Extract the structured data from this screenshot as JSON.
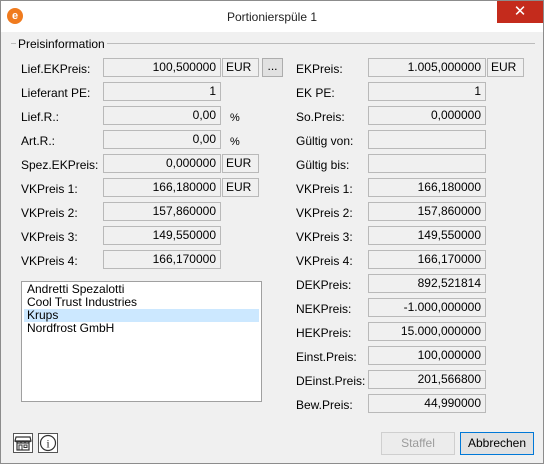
{
  "window": {
    "title": "Portionierspüle 1",
    "close_glyph": "✕",
    "app_icon_letter": "e"
  },
  "group": {
    "label": "Preisinformation"
  },
  "left": {
    "lief_ekpreis": {
      "label": "Lief.EKPreis:",
      "value": "100,500000",
      "currency": "EUR",
      "more_label": "..."
    },
    "lieferant_pe": {
      "label": "Lieferant PE:",
      "value": "1"
    },
    "lief_r": {
      "label": "Lief.R.:",
      "value": "0,00",
      "unit": "%"
    },
    "art_r": {
      "label": "Art.R.:",
      "value": "0,00",
      "unit": "%"
    },
    "spez_ekpreis": {
      "label": "Spez.EKPreis:",
      "value": "0,000000",
      "currency": "EUR"
    },
    "vkpreis1": {
      "label": "VKPreis 1:",
      "value": "166,180000",
      "currency": "EUR"
    },
    "vkpreis2": {
      "label": "VKPreis 2:",
      "value": "157,860000"
    },
    "vkpreis3": {
      "label": "VKPreis 3:",
      "value": "149,550000"
    },
    "vkpreis4": {
      "label": "VKPreis 4:",
      "value": "166,170000"
    }
  },
  "right": {
    "ekpreis": {
      "label": "EKPreis:",
      "value": "1.005,000000",
      "currency": "EUR"
    },
    "ek_pe": {
      "label": "EK PE:",
      "value": "1"
    },
    "so_preis": {
      "label": "So.Preis:",
      "value": "0,000000"
    },
    "gueltig_von": {
      "label": "Gültig von:",
      "value": ""
    },
    "gueltig_bis": {
      "label": "Gültig bis:",
      "value": ""
    },
    "vkpreis1": {
      "label": "VKPreis 1:",
      "value": "166,180000"
    },
    "vkpreis2": {
      "label": "VKPreis 2:",
      "value": "157,860000"
    },
    "vkpreis3": {
      "label": "VKPreis 3:",
      "value": "149,550000"
    },
    "vkpreis4": {
      "label": "VKPreis 4:",
      "value": "166,170000"
    },
    "dekpreis": {
      "label": "DEKPreis:",
      "value": "892,521814"
    },
    "nekpreis": {
      "label": "NEKPreis:",
      "value": "-1.000,000000"
    },
    "hekpreis": {
      "label": "HEKPreis:",
      "value": "15.000,000000"
    },
    "einst_preis": {
      "label": "Einst.Preis:",
      "value": "100,000000"
    },
    "deinst_preis": {
      "label": "DEinst.Preis:",
      "value": "201,566800"
    },
    "bew_preis": {
      "label": "Bew.Preis:",
      "value": "44,990000"
    }
  },
  "suppliers": {
    "items": [
      "Andretti Spezalotti",
      "Cool Trust Industries",
      "Krups",
      "Nordfrost GmbH"
    ],
    "selected": "Krups"
  },
  "footer": {
    "store_icon": "store-icon",
    "info_icon": "info-icon",
    "info_glyph": "i",
    "staffel_label": "Staffel",
    "abbrechen_label": "Abbrechen"
  },
  "colors": {
    "close_bg": "#c42b1c",
    "selection": "#cce8ff",
    "accent": "#0078d7",
    "app_icon": "#f07b1e"
  }
}
